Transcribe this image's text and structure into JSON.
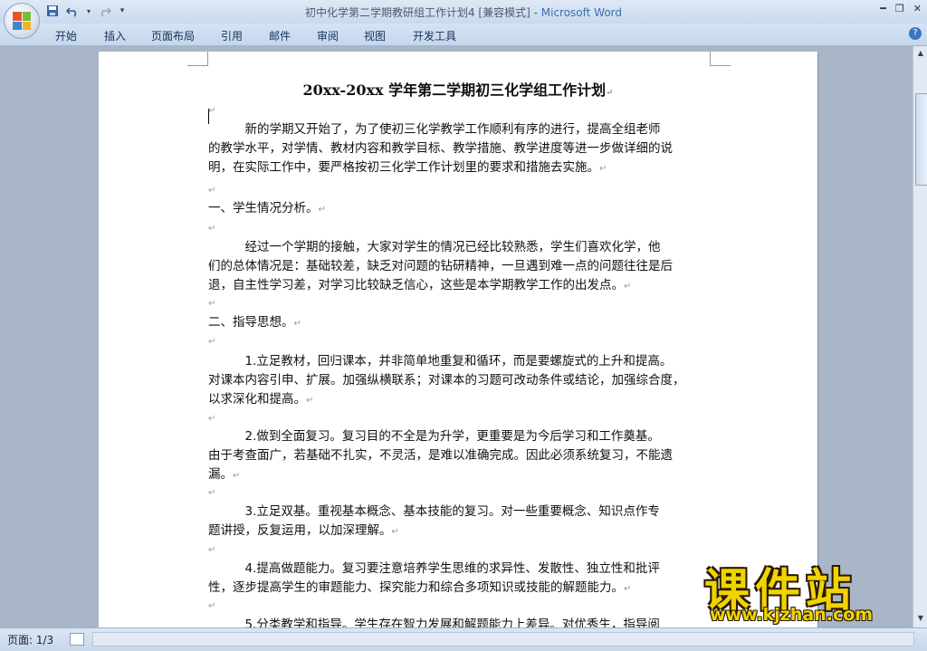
{
  "window": {
    "title_doc": "初中化学第二学期教研组工作计划4 [兼容模式] - ",
    "title_app": "Microsoft Word"
  },
  "ribbon": {
    "tabs": [
      "开始",
      "插入",
      "页面布局",
      "引用",
      "邮件",
      "审阅",
      "视图",
      "开发工具"
    ]
  },
  "document": {
    "title": "20xx-20xx 学年第二学期初三化学组工作计划",
    "paragraphs": [
      {
        "lines": [
          "　　　新的学期又开始了，为了使初三化学教学工作顺利有序的进行，提高全组老师",
          "的教学水平，对学情、教材内容和教学目标、教学措施、教学进度等进一步做详细的说",
          "明，在实际工作中，要严格按初三化学工作计划里的要求和措施去实施。"
        ]
      },
      {
        "lines": [
          "一、学生情况分析。"
        ]
      },
      {
        "lines": [
          "　　　经过一个学期的接触，大家对学生的情况已经比较熟悉，学生们喜欢化学，他",
          "们的总体情况是：基础较差，缺乏对问题的钻研精神，一旦遇到难一点的问题往往是后",
          "退，自主性学习差，对学习比较缺乏信心，这些是本学期教学工作的出发点。"
        ]
      },
      {
        "lines": [
          "二、指导思想。"
        ]
      },
      {
        "lines": [
          "　　　1.立足教材，回归课本，并非简单地重复和循环，而是要螺旋式的上升和提高。",
          "对课本内容引申、扩展。加强纵横联系；对课本的习题可改动条件或结论，加强综合度，",
          "以求深化和提高。"
        ]
      },
      {
        "lines": [
          "　　　2.做到全面复习。复习目的不全是为升学，更重要是为今后学习和工作奠基。",
          "由于考查面广，若基础不扎实，不灵活，是难以准确完成。因此必须系统复习，不能遗",
          "漏。"
        ]
      },
      {
        "lines": [
          "　　　3.立足双基。重视基本概念、基本技能的复习。对一些重要概念、知识点作专",
          "题讲授，反复运用，以加深理解。"
        ]
      },
      {
        "lines": [
          "　　　4.提高做题能力。复习要注意培养学生思维的求异性、发散性、独立性和批评",
          "性，逐步提高学生的审题能力、探究能力和综合多项知识或技能的解题能力。"
        ]
      },
      {
        "lines": [
          "　　　5.分类教学和指导。学生存在智力发展和解题能力上差异。对优秀生，指导阅"
        ]
      }
    ]
  },
  "status": {
    "page": "页面: 1/3"
  },
  "watermark": {
    "big": "课件站",
    "url": "www.kjzhan.com"
  },
  "icons": {
    "office": "office-button-icon",
    "save": "save-icon",
    "undo": "undo-icon",
    "redo": "redo-icon",
    "help": "help-icon"
  }
}
